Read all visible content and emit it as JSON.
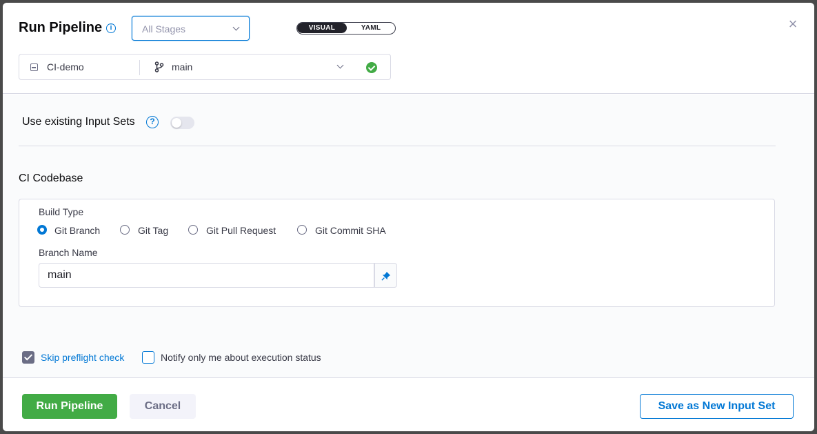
{
  "header": {
    "title": "Run Pipeline",
    "stage_select": {
      "value": "All Stages"
    },
    "view_toggle": {
      "visual_label": "VISUAL",
      "yaml_label": "YAML",
      "active": "VISUAL"
    },
    "repo": {
      "name": "CI-demo"
    },
    "branch": {
      "name": "main",
      "status": "valid"
    }
  },
  "input_sets": {
    "label": "Use existing Input Sets",
    "enabled": false
  },
  "codebase": {
    "section_title": "CI Codebase",
    "build_type_label": "Build Type",
    "build_types": [
      {
        "label": "Git Branch",
        "selected": true
      },
      {
        "label": "Git Tag",
        "selected": false
      },
      {
        "label": "Git Pull Request",
        "selected": false
      },
      {
        "label": "Git Commit SHA",
        "selected": false
      }
    ],
    "branch_name_label": "Branch Name",
    "branch_name_value": "main"
  },
  "options": {
    "skip_preflight": {
      "label": "Skip preflight check",
      "checked": true
    },
    "notify_only_me": {
      "label": "Notify only me about execution status",
      "checked": false
    }
  },
  "footer": {
    "run_label": "Run Pipeline",
    "cancel_label": "Cancel",
    "save_label": "Save as New Input Set"
  },
  "colors": {
    "accent": "#0278d5",
    "success": "#42ab45",
    "text": "#22222a",
    "muted": "#6b6d85"
  }
}
